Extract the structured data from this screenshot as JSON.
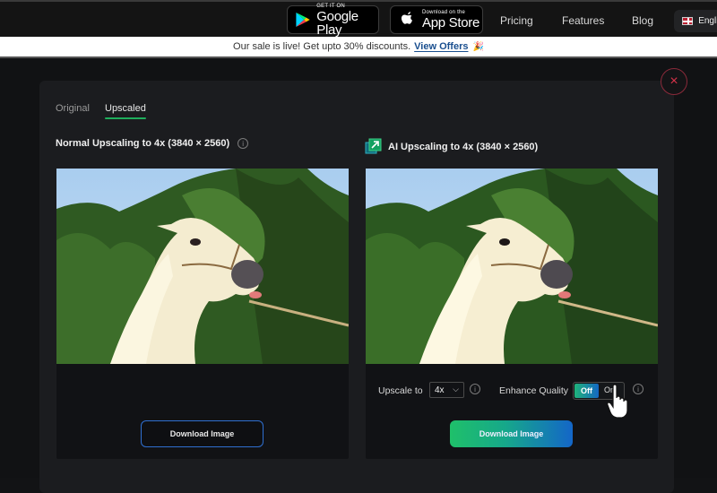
{
  "nav": {
    "google_play": {
      "small": "GET IT ON",
      "big": "Google Play"
    },
    "app_store": {
      "small": "Download on the",
      "big": "App Store"
    },
    "links": [
      "Pricing",
      "Features",
      "Blog"
    ],
    "language": "English"
  },
  "banner": {
    "text": "Our sale is live! Get upto 30% discounts.",
    "link": "View Offers",
    "emoji": "🎉"
  },
  "modal": {
    "close_icon": "×",
    "tabs": [
      {
        "label": "Original",
        "active": false
      },
      {
        "label": "Upscaled",
        "active": true
      }
    ],
    "left": {
      "heading": "Normal Upscaling to 4x (3840 × 2560)",
      "info": "i",
      "download_label": "Download Image"
    },
    "right": {
      "heading": "AI Upscaling to 4x (3840 × 2560)",
      "upscale_label": "Upscale to",
      "upscale_value": "4x",
      "chevron": "⌵",
      "info": "i",
      "enhance_label": "Enhance Quality",
      "toggle_off": "Off",
      "toggle_on": "On",
      "toggle_state": "Off",
      "download_label": "Download Image"
    }
  },
  "colors": {
    "accent_green": "#1fae5c",
    "accent_blue": "#1466c8",
    "close_red": "#d8334a",
    "offer_link": "#1a4f8f"
  }
}
